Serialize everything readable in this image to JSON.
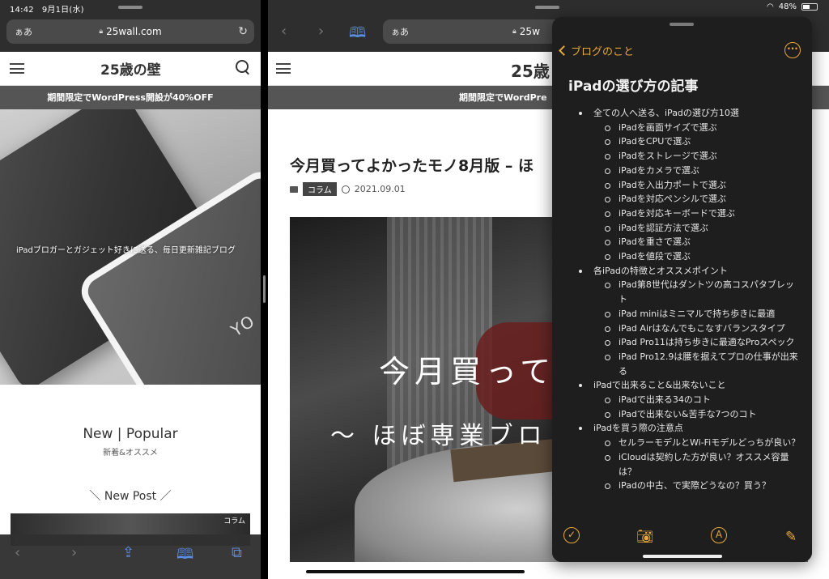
{
  "status": {
    "time": "14:42",
    "date": "9月1日(水)",
    "battery": "48%"
  },
  "left_pane": {
    "url_aa": "ぁあ",
    "url": "25wall.com",
    "site_title": "25歳の壁",
    "promo": "期間限定でWordPress開設が40%OFF",
    "hero_tagline": "iPadブロガーとガジェット好きに送る、毎日更新雑記ブログ",
    "hero_logo_text": "YO",
    "section_title": "New | Popular",
    "section_sub": "新着&オススメ",
    "new_post_heading": "＼ New Post ／",
    "card_category": "コラム"
  },
  "right_pane": {
    "url_aa": "ぁあ",
    "url": "25w",
    "site_title": "25歳",
    "promo": "期間限定でWordPre",
    "article_title": "今月買ってよかったモノ8月版 – ほ",
    "article_category": "コラム",
    "article_date": "2021.09.01",
    "image_text_1": "今月買って",
    "image_text_2": "〜 ほぼ専業ブロ"
  },
  "notes": {
    "back_label": "ブログのこと",
    "more": "···",
    "title": "iPadの選び方の記事",
    "sections": [
      {
        "label": "全ての人へ送る、iPadの選び方10選",
        "items": [
          "iPadを画面サイズで選ぶ",
          "iPadをCPUで選ぶ",
          "iPadをストレージで選ぶ",
          "iPadをカメラで選ぶ",
          "iPadを入出力ポートで選ぶ",
          "iPadを対応ペンシルで選ぶ",
          "iPadを対応キーボードで選ぶ",
          "iPadを認証方法で選ぶ",
          "iPadを重さで選ぶ",
          "iPadを値段で選ぶ"
        ]
      },
      {
        "label": "各iPadの特徴とオススメポイント",
        "items": [
          "iPad第8世代はダントツの高コスパタブレット",
          "iPad miniはミニマルで持ち歩きに最適",
          "iPad Airはなんでもこなすバランスタイプ",
          "iPad Pro11は持ち歩きに最適なProスペック",
          "iPad Pro12.9は腰を据えてプロの仕事が出来る"
        ]
      },
      {
        "label": "iPadで出来ること&出来ないこと",
        "items": [
          "iPadで出来る34のコト",
          "iPadで出来ない&苦手な7つのコト"
        ]
      },
      {
        "label": "iPadを買う際の注意点",
        "items": [
          "セルラーモデルとWi-Fiモデルどっちが良い？",
          "iCloudは契約した方が良い？オススメ容量は？",
          "iPadの中古、で実際どうなの？買う？"
        ]
      }
    ]
  },
  "icons": {
    "accent": "#e8a93a",
    "safari_blue": "#5b8de0"
  }
}
